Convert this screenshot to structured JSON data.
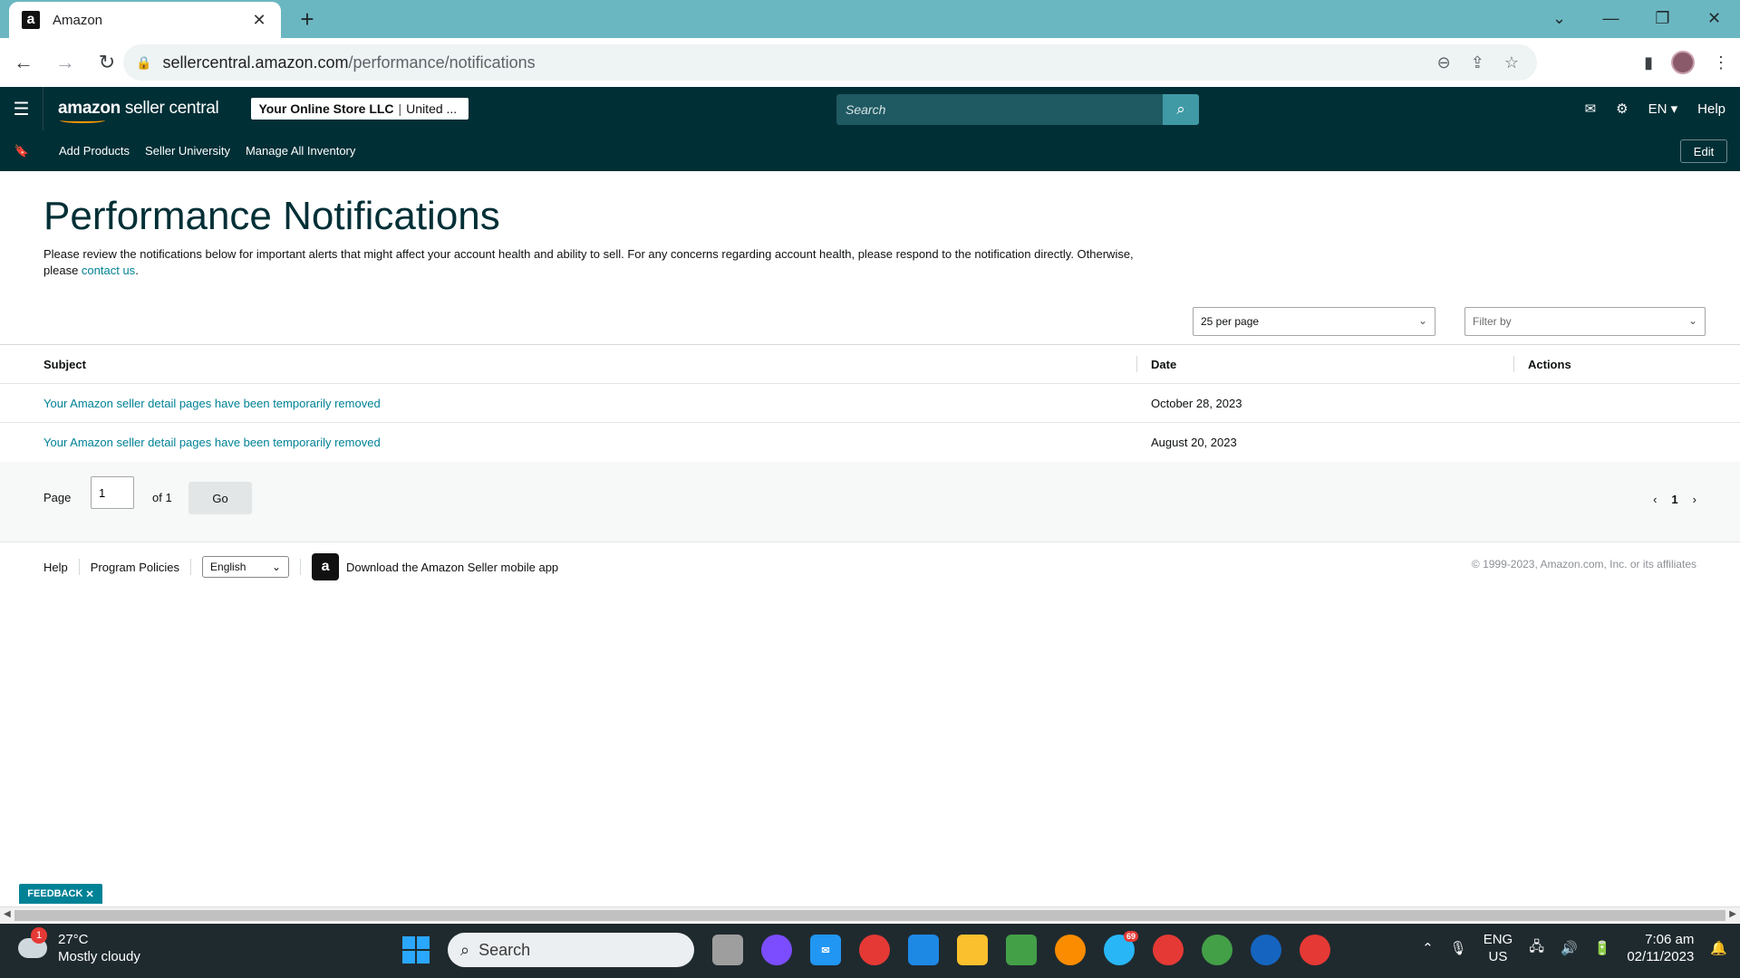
{
  "browser": {
    "tab_title": "Amazon",
    "favicon_letter": "a",
    "url_host": "sellercentral.amazon.com",
    "url_path": "/performance/notifications"
  },
  "header": {
    "brand_bold": "amazon",
    "brand_rest": " seller central",
    "store_name": "Your Online Store LLC",
    "store_region": "United ...",
    "search_placeholder": "Search",
    "language": "EN",
    "help": "Help"
  },
  "subnav": {
    "items": [
      "Add Products",
      "Seller University",
      "Manage All Inventory"
    ],
    "edit": "Edit"
  },
  "page": {
    "title": "Performance Notifications",
    "intro_text": "Please review the notifications below for important alerts that might affect your account health and ability to sell. For any concerns regarding account health, please respond to the notification directly. Otherwise, please ",
    "contact_link": "contact us",
    "intro_end": ".",
    "per_page": "25 per page",
    "filter_placeholder": "Filter by"
  },
  "table": {
    "headers": {
      "subject": "Subject",
      "date": "Date",
      "actions": "Actions"
    },
    "rows": [
      {
        "subject": "Your Amazon seller detail pages have been temporarily removed",
        "date": "October 28, 2023"
      },
      {
        "subject": "Your Amazon seller detail pages have been temporarily removed",
        "date": "August 20, 2023"
      }
    ]
  },
  "pagination": {
    "page_label": "Page",
    "page_value": "1",
    "of_label": "of 1",
    "go": "Go",
    "current": "1"
  },
  "footer": {
    "help": "Help",
    "policies": "Program Policies",
    "language": "English",
    "app_text": "Download the Amazon Seller mobile app",
    "copyright": "© 1999-2023, Amazon.com, Inc. or its affiliates"
  },
  "feedback": "FEEDBACK",
  "taskbar": {
    "weather_temp": "27°C",
    "weather_desc": "Mostly cloudy",
    "weather_badge": "1",
    "search": "Search",
    "telegram_badge": "69",
    "lang_1": "ENG",
    "lang_2": "US",
    "time": "7:06 am",
    "date": "02/11/2023"
  },
  "colors": {
    "header_bg": "#002f36",
    "link": "#008296",
    "tab_strip": "#6bb7c1"
  }
}
